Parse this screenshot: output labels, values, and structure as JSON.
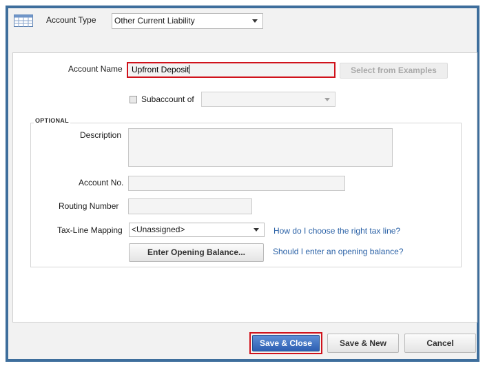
{
  "header": {
    "account_type_label": "Account Type",
    "account_type_value": "Other Current Liability"
  },
  "form": {
    "account_name_label": "Account Name",
    "account_name_value": "Upfront Deposit",
    "select_examples_label": "Select from Examples",
    "subaccount_label": "Subaccount of",
    "subaccount_value": "",
    "optional_title": "OPTIONAL",
    "description_label": "Description",
    "account_no_label": "Account No.",
    "routing_number_label": "Routing Number",
    "tax_line_label": "Tax-Line Mapping",
    "tax_line_value": "<Unassigned>",
    "tax_line_help": "How do I choose the right tax line?",
    "opening_balance_button": "Enter Opening Balance...",
    "opening_balance_help": "Should I enter an opening balance?"
  },
  "footer": {
    "save_close": "Save & Close",
    "save_new": "Save & New",
    "cancel": "Cancel"
  },
  "colors": {
    "frame_border": "#3e6e9c",
    "highlight": "#d0121b",
    "link": "#2a61a6",
    "primary_button": "#2d5fb2"
  }
}
